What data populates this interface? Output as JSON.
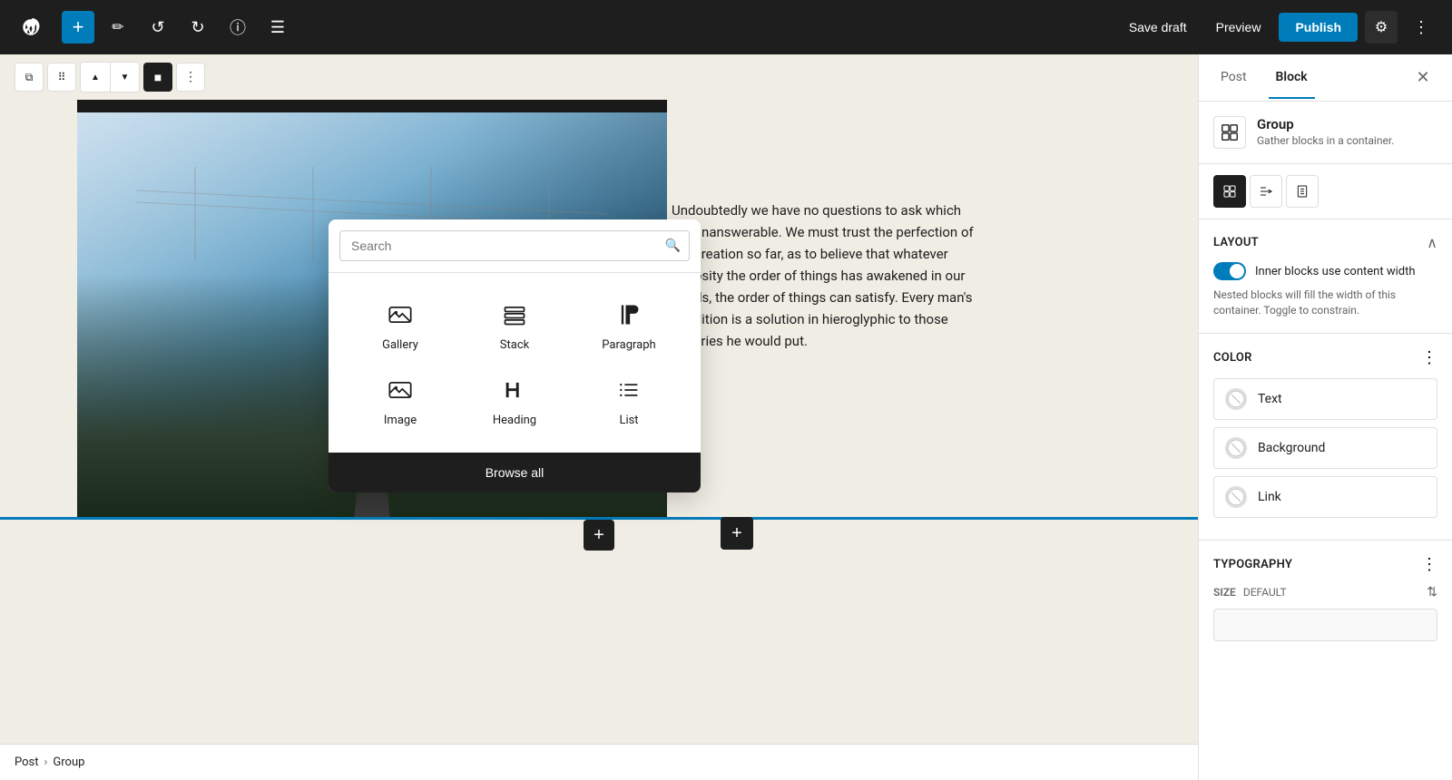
{
  "toolbar": {
    "add_label": "+",
    "save_draft_label": "Save draft",
    "preview_label": "Preview",
    "publish_label": "Publish",
    "undo_icon": "↺",
    "redo_icon": "↻",
    "info_icon": "ℹ",
    "list_view_icon": "≡",
    "settings_icon": "⚙",
    "more_icon": "⋮"
  },
  "block_toolbar": {
    "group_icon": "⧉",
    "drag_icon": "⠿",
    "up_icon": "▲",
    "down_icon": "▼",
    "align_icon": "■",
    "more_icon": "⋮"
  },
  "inserter": {
    "search_placeholder": "Search",
    "items": [
      {
        "id": "gallery",
        "label": "Gallery",
        "icon": "🖼"
      },
      {
        "id": "stack",
        "label": "Stack",
        "icon": "⊟"
      },
      {
        "id": "paragraph",
        "label": "Paragraph",
        "icon": "¶"
      },
      {
        "id": "image",
        "label": "Image",
        "icon": "🏔"
      },
      {
        "id": "heading",
        "label": "Heading",
        "icon": "🔖"
      },
      {
        "id": "list",
        "label": "List",
        "icon": "≡"
      }
    ],
    "browse_all_label": "Browse all"
  },
  "content_text": "Undoubtedly we have no questions to ask which are unanswerable. We must trust the perfection of the creation so far, as to believe that whatever curiosity the order of things has awakened in our minds, the order of things can satisfy. Every man's condition is a solution in hieroglyphic to those inquiries he would put.",
  "right_panel": {
    "tab_post": "Post",
    "tab_block": "Block",
    "block_name": "Group",
    "block_desc": "Gather blocks in a container.",
    "action_group_icon": "⧉",
    "action_justify_icon": "⊢",
    "action_constrain_icon": "⊣",
    "layout_section_title": "Layout",
    "layout_toggle_label": "Inner blocks use content width",
    "layout_toggle_desc": "Nested blocks will fill the width of this container. Toggle to constrain.",
    "color_section_title": "Color",
    "color_more_icon": "⋮",
    "colors": [
      {
        "id": "text",
        "label": "Text"
      },
      {
        "id": "background",
        "label": "Background"
      },
      {
        "id": "link",
        "label": "Link"
      }
    ],
    "typography_section_title": "Typography",
    "typography_more_icon": "⋮",
    "size_label": "SIZE",
    "size_value": "DEFAULT"
  },
  "breadcrumb": {
    "post_label": "Post",
    "separator": "›",
    "group_label": "Group"
  }
}
